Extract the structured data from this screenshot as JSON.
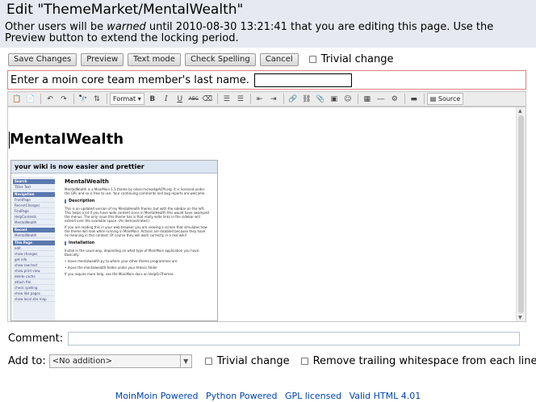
{
  "header": {
    "title": "Edit \"ThemeMarket/MentalWealth\"",
    "warning_prefix": "Other users will be ",
    "warning_em": "warned",
    "warning_suffix": " until 2010-08-30 13:21:41 that you are editing this page. Use the Preview button to extend the locking period."
  },
  "buttons": {
    "save": "Save Changes",
    "preview": "Preview",
    "text_mode": "Text mode",
    "check_spelling": "Check Spelling",
    "cancel": "Cancel"
  },
  "trivial_change_label": "Trivial change",
  "captcha": {
    "label": "Enter a moin core team member's last name.",
    "value": ""
  },
  "toolbar": {
    "format_label": "Format",
    "source_label": "Source",
    "icons": [
      "paste-icon",
      "paste-word-icon",
      "undo-icon",
      "redo-icon",
      "find-icon",
      "replace-icon",
      "bold-icon",
      "italic-icon",
      "underline-icon",
      "strike-icon",
      "remove-format-icon",
      "numbered-list-icon",
      "bullet-list-icon",
      "outdent-icon",
      "indent-icon",
      "link-icon",
      "unlink-icon",
      "attachment-icon",
      "image-icon",
      "smiley-icon",
      "table-icon",
      "horizontal-rule-icon",
      "macro-icon",
      "highlight-icon",
      "source-icon"
    ]
  },
  "editor": {
    "heading": "MentalWealth",
    "screenshot": {
      "slogan": "your wiki is now easier and prettier",
      "sidebar_sections": [
        {
          "title": "Search",
          "items": [
            "Titles",
            "Text"
          ]
        },
        {
          "title": "Navigation",
          "items": [
            "FrontPage",
            "RecentChanges",
            "FindPage",
            "HelpContents",
            "MentalWealth"
          ]
        },
        {
          "title": "Recent",
          "items": [
            "MentalWealth"
          ]
        },
        {
          "title": "This Page",
          "items": [
            "edit",
            "show changes",
            "get info",
            "show raw text",
            "show print view",
            "delete cache",
            "attach file",
            "check spelling",
            "show like pages",
            "show local site map"
          ]
        }
      ],
      "main_title": "MentalWealth",
      "intro": "MentalWealth is a MoinMoin 1.5 theme by oliver.mcleod@ACM.org. It is licensed under the GPL and so is free to use. Your continuing comments and bug reports are welcome.",
      "section1": "Description",
      "desc1": "This is an updated version of my MentalHealth theme, but with the sidebar on the left. This helps a lot if you have wide content since in MentalHealth this would have swamped the menus. The only issue this theme has is that really wide links in the sidebar will extend over the available space. (As demonstrated.)",
      "desc2": "If you are reading this in your web browser you are viewing a screen that simulates how the theme will look while running in MoinMoin. Actions are disabled because they have no meaning in this context. Of course they will work correctly in a real wiki!",
      "section2": "Installation",
      "install": "Install in the usual way, depending on what type of MoinMoin application you have. Basically:",
      "bullets": [
        "move mentalwealth.py to where your other theme programmes are",
        "move the mentalwealth folder under your htdocs folder"
      ],
      "more": "If you require more help, see the MoinMoin docs on HelpOnThemes"
    }
  },
  "comment": {
    "label": "Comment:",
    "value": ""
  },
  "add_to": {
    "label": "Add to:",
    "selected": "<No addition>"
  },
  "options": {
    "trivial": "Trivial change",
    "remove_ws": "Remove trailing whitespace from each line"
  },
  "footer": [
    "MoinMoin Powered",
    "Python Powered",
    "GPL licensed",
    "Valid HTML 4.01"
  ]
}
